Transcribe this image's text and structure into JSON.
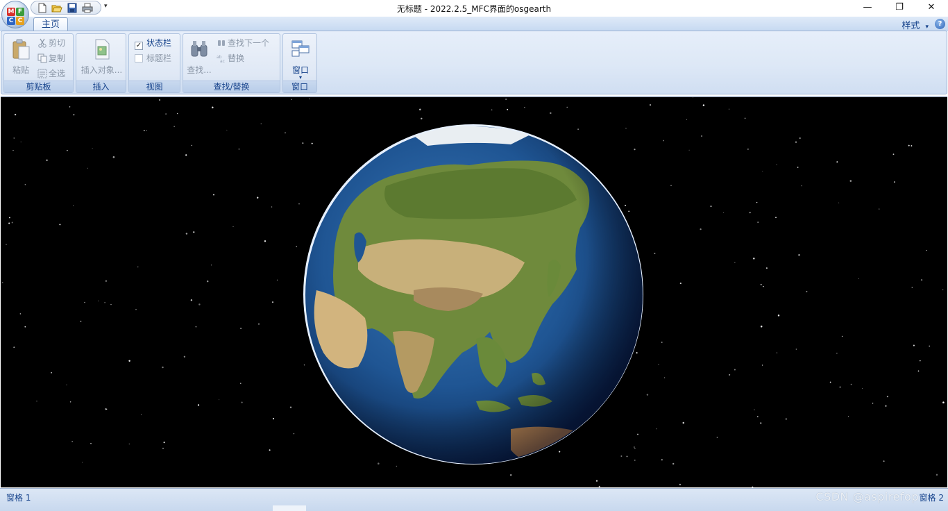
{
  "window": {
    "title": "无标题 - 2022.2.5_MFC界面的osgearth",
    "app_button_letters": [
      "M",
      "F",
      "C",
      "C"
    ],
    "controls": {
      "minimize": "—",
      "maximize": "❐",
      "close": "✕"
    }
  },
  "quick_access": {
    "items": [
      "new-file-icon",
      "open-folder-icon",
      "save-icon",
      "print-icon"
    ],
    "dropdown": "▾"
  },
  "tabs": [
    {
      "label": "主页",
      "active": true
    }
  ],
  "style_menu": {
    "label": "样式",
    "arrow": "▾"
  },
  "help": {
    "glyph": "?"
  },
  "ribbon": {
    "clipboard": {
      "label": "剪贴板",
      "paste": "粘贴",
      "cut": "剪切",
      "copy": "复制",
      "select_all": "全选"
    },
    "insert": {
      "label": "插入",
      "insert_object": "插入对象..."
    },
    "view": {
      "label": "视图",
      "status_bar": {
        "label": "状态栏",
        "checked": true,
        "mark": "✓"
      },
      "caption_bar": {
        "label": "标题栏",
        "checked": false
      }
    },
    "find_replace": {
      "label": "查找/替换",
      "find": "查找...",
      "find_next": "查找下一个",
      "replace": "替换"
    },
    "window": {
      "label": "窗口",
      "window_btn": "窗口",
      "arrow": "▾"
    }
  },
  "viewport": {
    "content": "3D globe (osgEarth) centered on Asia over starfield",
    "colors": {
      "space": "#000000",
      "ocean": "#1d4f8c",
      "land": "#6f8a3c",
      "desert": "#c8b07a"
    }
  },
  "status_bar": {
    "left": "窗格 1",
    "right": "窗格 2",
    "watermark": "CSDN @aspirefop"
  },
  "colors": {
    "accent": "#15428b",
    "ribbon_bg": "#dde8f6",
    "disabled_text": "#8c98a8"
  }
}
